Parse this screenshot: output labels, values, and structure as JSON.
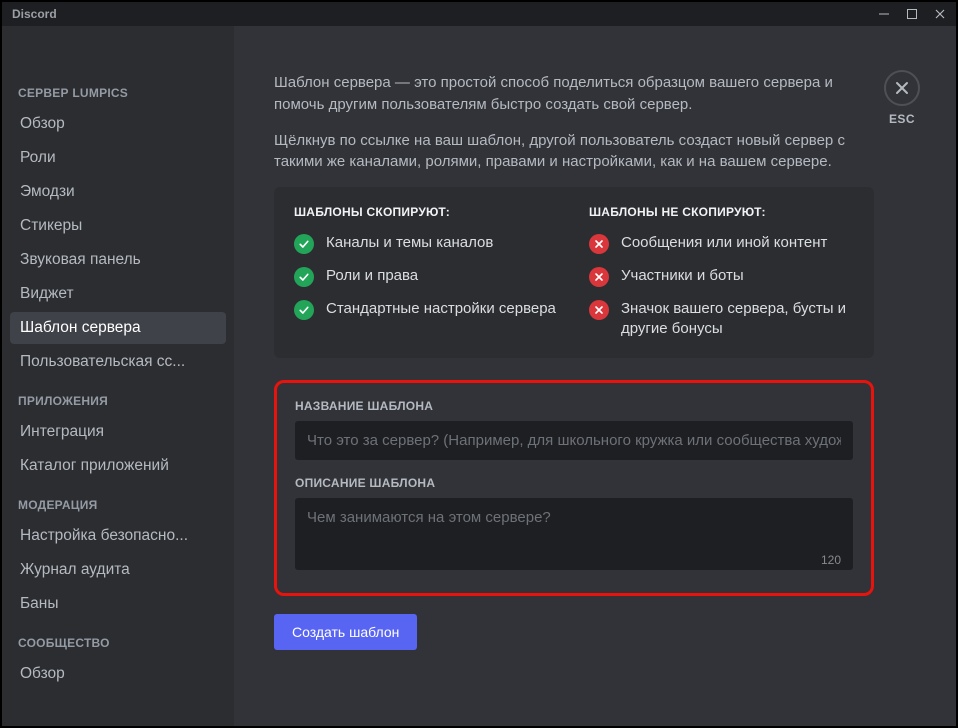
{
  "titlebar": {
    "title": "Discord"
  },
  "esc": {
    "label": "ESC"
  },
  "sidebar": {
    "sections": [
      {
        "heading": "СЕРВЕР LUMPICS",
        "items": [
          {
            "label": "Обзор",
            "active": false
          },
          {
            "label": "Роли",
            "active": false
          },
          {
            "label": "Эмодзи",
            "active": false
          },
          {
            "label": "Стикеры",
            "active": false
          },
          {
            "label": "Звуковая панель",
            "active": false
          },
          {
            "label": "Виджет",
            "active": false
          },
          {
            "label": "Шаблон сервера",
            "active": true
          },
          {
            "label": "Пользовательская сс...",
            "active": false
          }
        ]
      },
      {
        "heading": "ПРИЛОЖЕНИЯ",
        "items": [
          {
            "label": "Интеграция",
            "active": false
          },
          {
            "label": "Каталог приложений",
            "active": false
          }
        ]
      },
      {
        "heading": "МОДЕРАЦИЯ",
        "items": [
          {
            "label": "Настройка безопасно...",
            "active": false
          },
          {
            "label": "Журнал аудита",
            "active": false
          },
          {
            "label": "Баны",
            "active": false
          }
        ]
      },
      {
        "heading": "СООБЩЕСТВО",
        "items": [
          {
            "label": "Обзор",
            "active": false
          }
        ]
      }
    ]
  },
  "main": {
    "intro1": "Шаблон сервера — это простой способ поделиться образцом вашего сервера и помочь другим пользователям быстро создать свой сервер.",
    "intro2": "Щёлкнув по ссылке на ваш шаблон, другой пользователь создаст новый сервер с такими же каналами, ролями, правами и настройками, как и на вашем сервере.",
    "will": {
      "heading": "ШАБЛОНЫ СКОПИРУЮТ:",
      "items": [
        "Каналы и темы каналов",
        "Роли и права",
        "Стандартные настройки сервера"
      ]
    },
    "wont": {
      "heading": "ШАБЛОНЫ НЕ СКОПИРУЮТ:",
      "items": [
        "Сообщения или иной контент",
        "Участники и боты",
        "Значок вашего сервера, бусты и другие бонусы"
      ]
    },
    "form": {
      "name_label": "НАЗВАНИЕ ШАБЛОНА",
      "name_placeholder": "Что это за сервер? (Например, для школьного кружка или сообщества художников)",
      "desc_label": "ОПИСАНИЕ ШАБЛОНА",
      "desc_placeholder": "Чем занимаются на этом сервере?",
      "counter": "120",
      "button": "Создать шаблон"
    }
  }
}
